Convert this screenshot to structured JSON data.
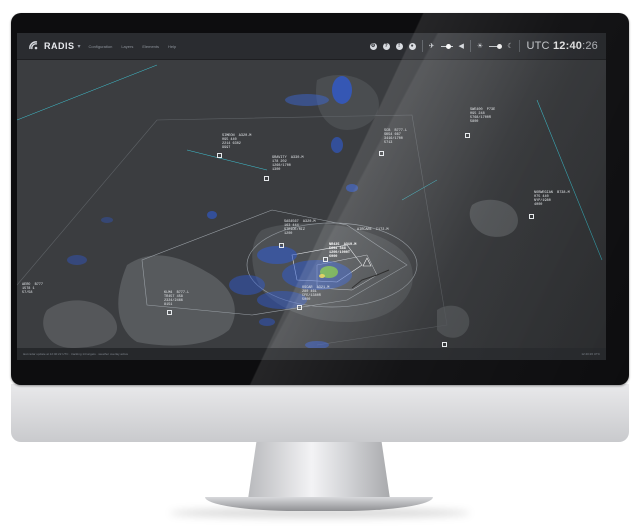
{
  "app": {
    "name": "RADIS",
    "menu": [
      "Configuration",
      "Layers",
      "Elements",
      "Help"
    ]
  },
  "toolbar": {
    "icons": [
      "settings-icon",
      "help-icon",
      "alert-icon",
      "gear-icon",
      "plane-icon",
      "brightness-icon",
      "volume-icon",
      "sun-icon",
      "moon-icon"
    ],
    "clock_prefix": "UTC",
    "clock_hm": "12:40",
    "clock_sec": ":26"
  },
  "flights": [
    {
      "id": "f1",
      "lines": [
        "SIMEON  A320-M",
        "095 440",
        "2214 6302",
        "9997"
      ]
    },
    {
      "id": "f2",
      "lines": [
        "GRAVITY  A330-M",
        "178 202",
        "1260/1700",
        "1300"
      ]
    },
    {
      "id": "f3",
      "lines": [
        "SWE400  P73E",
        "095 248",
        "5768/1700R",
        "5800"
      ]
    },
    {
      "id": "f4",
      "lines": [
        "SCB  B777-L",
        "SK54 667",
        "3416/1700",
        "5713"
      ]
    },
    {
      "id": "f5",
      "lines": [
        "NORWEGIAN  B738-M",
        "075 440",
        "NYP/1980",
        "4000"
      ]
    },
    {
      "id": "f6",
      "lines": [
        "SAS4567  A320-M",
        "163 444",
        "STRIDE/RIZ",
        "1200"
      ]
    },
    {
      "id": "f7",
      "lines": [
        "NR435  A319-M",
        "5854 388",
        "1200/1900T",
        "6000"
      ]
    },
    {
      "id": "f8",
      "lines": [
        "OSCAR  A321-M",
        "280 461",
        "CFE/1380R",
        "5000"
      ]
    },
    {
      "id": "f9",
      "lines": [
        "KLM4  B777-L",
        "TR457 458",
        "2324/2466",
        "8151"
      ]
    },
    {
      "id": "f10",
      "lines": [
        "AERO  B777",
        "1578 1",
        "57/58"
      ]
    },
    {
      "id": "f11",
      "lines": [
        "AIRCARE  C172-M",
        "1104 442",
        "DRT/1200",
        "2044"
      ]
    }
  ],
  "statusbar": {
    "left": "last radar update at 12:40:22 UTC  ·  tracking 14 targets  ·  weather overlay active",
    "right": "12:40:26 UTC"
  },
  "colors": {
    "topbar": "#2a2c30",
    "map_background": "#3a3c3f",
    "land": "#57595c",
    "weather_blue": "#2f5bd6",
    "weather_green": "#7cc63a",
    "route_cyan": "#3fc7d6"
  }
}
